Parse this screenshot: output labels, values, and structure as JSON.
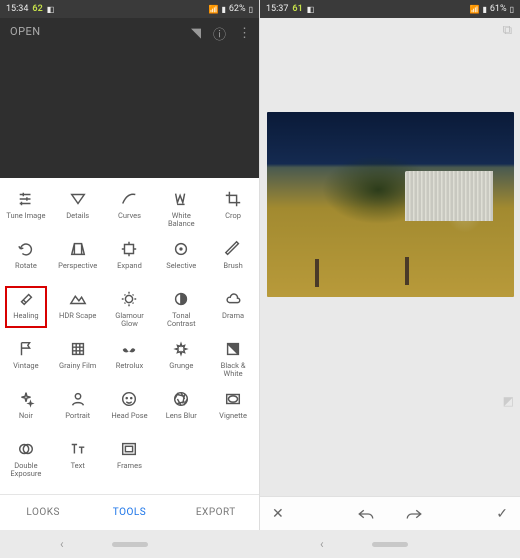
{
  "left": {
    "status": {
      "time": "15:34",
      "accent": "62",
      "extra": "◧",
      "battery": "62%",
      "icons": "▾ ⋮⋮"
    },
    "open_label": "OPEN",
    "tools": [
      {
        "key": "tune-image",
        "label": "Tune Image",
        "icon": "sliders"
      },
      {
        "key": "details",
        "label": "Details",
        "icon": "triangle-down"
      },
      {
        "key": "curves",
        "label": "Curves",
        "icon": "curve"
      },
      {
        "key": "white-balance",
        "label": "White\nBalance",
        "icon": "wb"
      },
      {
        "key": "crop",
        "label": "Crop",
        "icon": "crop"
      },
      {
        "key": "rotate",
        "label": "Rotate",
        "icon": "rotate"
      },
      {
        "key": "perspective",
        "label": "Perspective",
        "icon": "persp"
      },
      {
        "key": "expand",
        "label": "Expand",
        "icon": "expand"
      },
      {
        "key": "selective",
        "label": "Selective",
        "icon": "target"
      },
      {
        "key": "brush",
        "label": "Brush",
        "icon": "brush"
      },
      {
        "key": "healing",
        "label": "Healing",
        "icon": "bandage",
        "highlight": true
      },
      {
        "key": "hdr-scape",
        "label": "HDR Scape",
        "icon": "mountain"
      },
      {
        "key": "glamour-glow",
        "label": "Glamour\nGlow",
        "icon": "glow"
      },
      {
        "key": "tonal-contrast",
        "label": "Tonal\nContrast",
        "icon": "halfcircle"
      },
      {
        "key": "drama",
        "label": "Drama",
        "icon": "cloud"
      },
      {
        "key": "vintage",
        "label": "Vintage",
        "icon": "flag"
      },
      {
        "key": "grainy-film",
        "label": "Grainy Film",
        "icon": "film"
      },
      {
        "key": "retrolux",
        "label": "Retrolux",
        "icon": "mustache"
      },
      {
        "key": "grunge",
        "label": "Grunge",
        "icon": "splat"
      },
      {
        "key": "black-white",
        "label": "Black &\nWhite",
        "icon": "bw"
      },
      {
        "key": "noir",
        "label": "Noir",
        "icon": "sparkle"
      },
      {
        "key": "portrait",
        "label": "Portrait",
        "icon": "person"
      },
      {
        "key": "head-pose",
        "label": "Head Pose",
        "icon": "face"
      },
      {
        "key": "lens-blur",
        "label": "Lens Blur",
        "icon": "aperture"
      },
      {
        "key": "vignette",
        "label": "Vignette",
        "icon": "vignette"
      },
      {
        "key": "double-exposure",
        "label": "Double\nExposure",
        "icon": "dblexp"
      },
      {
        "key": "text",
        "label": "Text",
        "icon": "tt"
      },
      {
        "key": "frames",
        "label": "Frames",
        "icon": "frame"
      }
    ],
    "tabs": {
      "looks": "LOOKS",
      "tools": "TOOLS",
      "export": "EXPORT",
      "active": "tools"
    }
  },
  "right": {
    "status": {
      "time": "15:37",
      "accent": "61",
      "extra": "◧",
      "battery": "61%",
      "icons": "▾ ⋮⋮"
    },
    "actions": {
      "close": "✕",
      "undo": "undo",
      "redo": "redo",
      "apply": "✓"
    }
  }
}
